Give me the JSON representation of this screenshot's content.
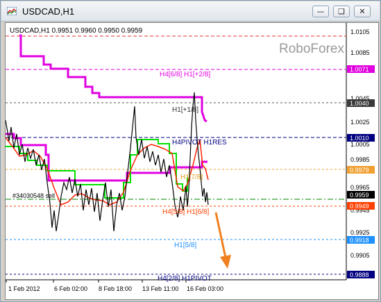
{
  "window": {
    "title": "USDCAD,H1",
    "minimize_glyph": "—",
    "restore_glyph": "❏",
    "close_glyph": "✕"
  },
  "chart": {
    "symbol_info": "USDCAD,H1  0.9951 0.9960 0.9950 0.9959",
    "watermark": "RoboForex",
    "order_label": "#34030548 sell",
    "x_axis_labels": [
      "1 Feb 2012",
      "6 Feb 02:00",
      "8 Feb 18:00",
      "13 Feb 11:00",
      "16 Feb 03:00"
    ],
    "y_axis_ticks": [
      "1.0105",
      "1.0085",
      "1.0045",
      "1.0025",
      "1.0005",
      "0.9985",
      "0.9965",
      "0.9945",
      "0.9925",
      "0.9905"
    ],
    "price_tags": [
      {
        "value": "1.0071",
        "color": "#e000e0"
      },
      {
        "value": "1.0040",
        "color": "#3a3a3a"
      },
      {
        "value": "1.0010",
        "color": "#000080"
      },
      {
        "value": "0.9979",
        "color": "#f0a030"
      },
      {
        "value": "0.9959",
        "color": "#000000"
      },
      {
        "value": "0.9949",
        "color": "#ff4000"
      },
      {
        "value": "0.9918",
        "color": "#1e90ff"
      },
      {
        "value": "0.9888",
        "color": "#000080"
      }
    ],
    "level_labels": [
      {
        "text": "H4[6/8] H1[+2/8]",
        "color": "#e000e0"
      },
      {
        "text": "H1[+1/8]",
        "color": "#333333"
      },
      {
        "text": "H4PIVOT H1RES",
        "color": "#000080"
      },
      {
        "text": "H1[7/8]",
        "color": "#e0a020"
      },
      {
        "text": "H4[5/8] H1[6/8]",
        "color": "#ff4000"
      },
      {
        "text": "H1[5/8]",
        "color": "#1e90ff"
      },
      {
        "text": "H4[2/8] H1PIVOT",
        "color": "#000080"
      }
    ]
  }
}
